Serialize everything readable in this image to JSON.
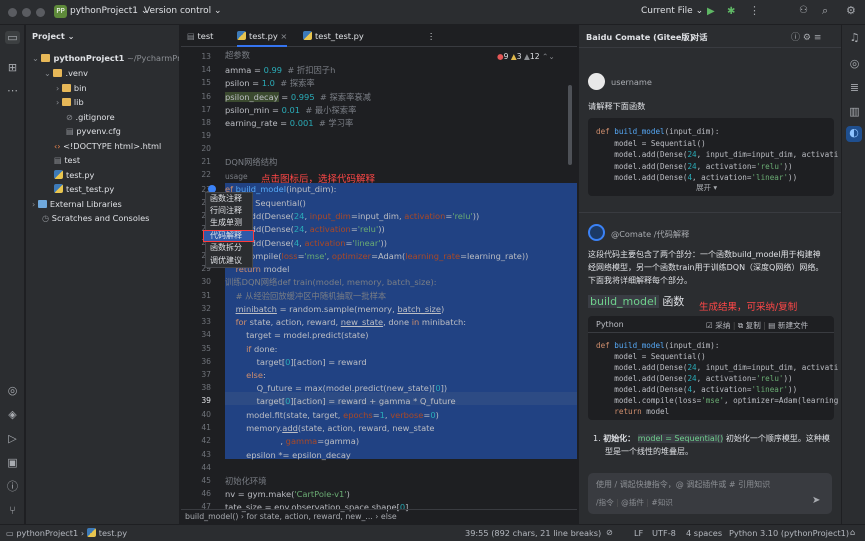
{
  "titlebar": {
    "project_badge": "PP",
    "project_name": "pythonProject1",
    "vcs": "Version control",
    "run_config": "Current File"
  },
  "project_panel": {
    "title": "Project",
    "tree": [
      {
        "label": "pythonProject1",
        "hint": "~/PycharmProject"
      },
      {
        "label": ".venv"
      },
      {
        "label": "bin"
      },
      {
        "label": "lib"
      },
      {
        "label": ".gitignore"
      },
      {
        "label": "pyvenv.cfg"
      },
      {
        "label": "<!DOCTYPE html>.html"
      },
      {
        "label": "test"
      },
      {
        "label": "test.py"
      },
      {
        "label": "test_test.py"
      },
      {
        "label": "External Libraries"
      },
      {
        "label": "Scratches and Consoles"
      }
    ]
  },
  "editor": {
    "tabs": [
      "test",
      "test.py",
      "test_test.py"
    ],
    "inspections": {
      "errors": "9",
      "warnings": "3",
      "weak": "12"
    },
    "line_numbers": [
      "13",
      "14",
      "15",
      "16",
      "17",
      "18",
      "19",
      "20",
      "21",
      "22",
      "23",
      "24",
      "25",
      "26",
      "27",
      "28",
      "29",
      "30",
      "31",
      "32",
      "33",
      "34",
      "35",
      "36",
      "37",
      "38",
      "39",
      "40",
      "41",
      "42",
      "43",
      "44",
      "45",
      "46",
      "47"
    ],
    "hint_params": "超参数",
    "hint_dqn": "DQN网络结构",
    "hint_usage": "usage",
    "hint_train": "训练DQN网络def train(model, memory, batch_size):",
    "hint_env": "初始化环境",
    "annotation": "点击图标后，选择代码解释",
    "breadcrumb": [
      "build_model()",
      "for state, action, reward, new_...",
      "else"
    ]
  },
  "context_menu": [
    "函数注释",
    "行间注释",
    "生成单测",
    "代码解释",
    "函数拆分",
    "调优建议"
  ],
  "comate": {
    "title": "Baidu Comate (Gitee版)",
    "tab": "对话",
    "username": "username",
    "user_message": "请解释下面函数",
    "bot_name": "@Comate",
    "bot_cmd": "/代码解释",
    "expand": "展开",
    "intro": "这段代码主要包含了两个部分：一个函数build_model用于构建神经网络模型，另一个函数train用于训练DQN（深度Q网络）网络。下面我将详细解释每个部分。",
    "heading": "build_model",
    "heading_suffix": "函数",
    "annotation": "生成结果，可采纳/复制",
    "code_lang": "Python",
    "code_actions": [
      "采纳",
      "复制",
      "新建文件"
    ],
    "explain_1a": "初始化：",
    "explain_1b": "model = Sequential()",
    "explain_1c": "初始化一个顺序模型。这种模",
    "explain_2": "型是一个线性的堆叠层。",
    "input_placeholder": "使用 / 调起快捷指令，@ 调起插件或 # 引用知识",
    "input_hints": [
      "/指令",
      "@插件",
      "#知识"
    ]
  },
  "statusbar": {
    "project": "pythonProject1",
    "file": "test.py",
    "position": "39:55 (892 chars, 21 line breaks)",
    "line_sep": "LF",
    "encoding": "UTF-8",
    "indent": "4 spaces",
    "interpreter": "Python 3.10 (pythonProject1)"
  }
}
